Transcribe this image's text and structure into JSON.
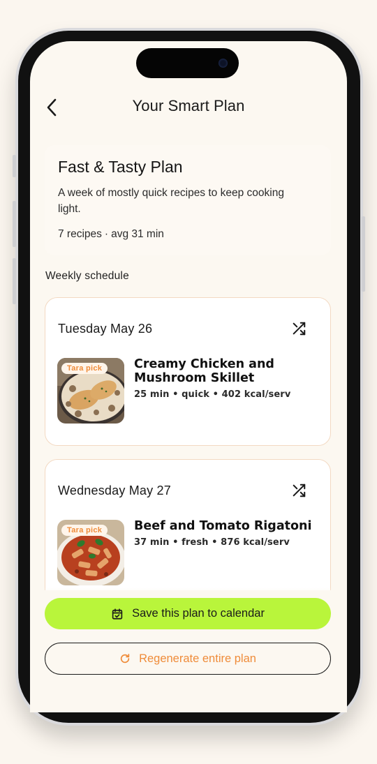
{
  "header": {
    "title": "Your Smart Plan",
    "back_icon": "chevron-left-icon"
  },
  "plan": {
    "name": "Fast & Tasty Plan",
    "description": "A week of mostly quick recipes to keep cooking light.",
    "recipe_count": "7 recipes",
    "separator": "·",
    "avg_time": "avg 31 min"
  },
  "schedule": {
    "label": "Weekly schedule",
    "days": [
      {
        "date": "Tuesday May 26",
        "badge": "Tara pick",
        "recipe": "Creamy Chicken and Mushroom Skillet",
        "meta": "25 min • quick • 402 kcal/serv"
      },
      {
        "date": "Wednesday May 27",
        "badge": "Tara pick",
        "recipe": "Beef and Tomato Rigatoni",
        "meta": "37 min • fresh • 876 kcal/serv"
      }
    ]
  },
  "actions": {
    "save_label": "Save this plan to calendar",
    "regenerate_label": "Regenerate entire plan"
  },
  "colors": {
    "accent_green": "#b9f53b",
    "accent_orange": "#ef8c3a",
    "background": "#fcf8f1",
    "card_border": "#f3d9c2"
  }
}
